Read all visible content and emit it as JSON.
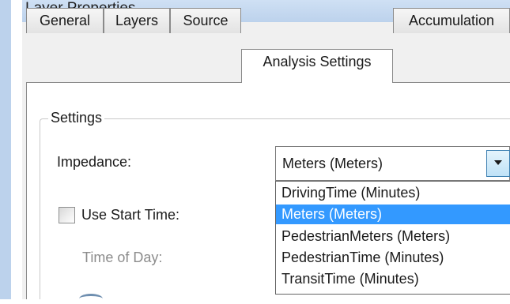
{
  "window": {
    "title": "Layer Properties"
  },
  "tabs": [
    {
      "label": "General"
    },
    {
      "label": "Layers"
    },
    {
      "label": "Source"
    },
    {
      "label": "Analysis Settings",
      "active": true
    },
    {
      "label": "Accumulation"
    }
  ],
  "settings": {
    "group_label": "Settings",
    "impedance_label": "Impedance:",
    "impedance_value": "Meters (Meters)",
    "options": [
      "DrivingTime (Minutes)",
      "Meters (Meters)",
      "PedestrianMeters (Meters)",
      "PedestrianTime (Minutes)",
      "TransitTime (Minutes)"
    ],
    "selected_option": "Meters (Meters)",
    "use_start_time_label": "Use Start Time:",
    "use_start_time_checked": false,
    "time_of_day_label": "Time of Day:"
  },
  "colors": {
    "selection": "#3399ff",
    "title_bar": "#bcd2ec",
    "disabled_text": "#8c8c8c"
  },
  "icons": {
    "combo_arrow": "chevron-down-icon"
  }
}
